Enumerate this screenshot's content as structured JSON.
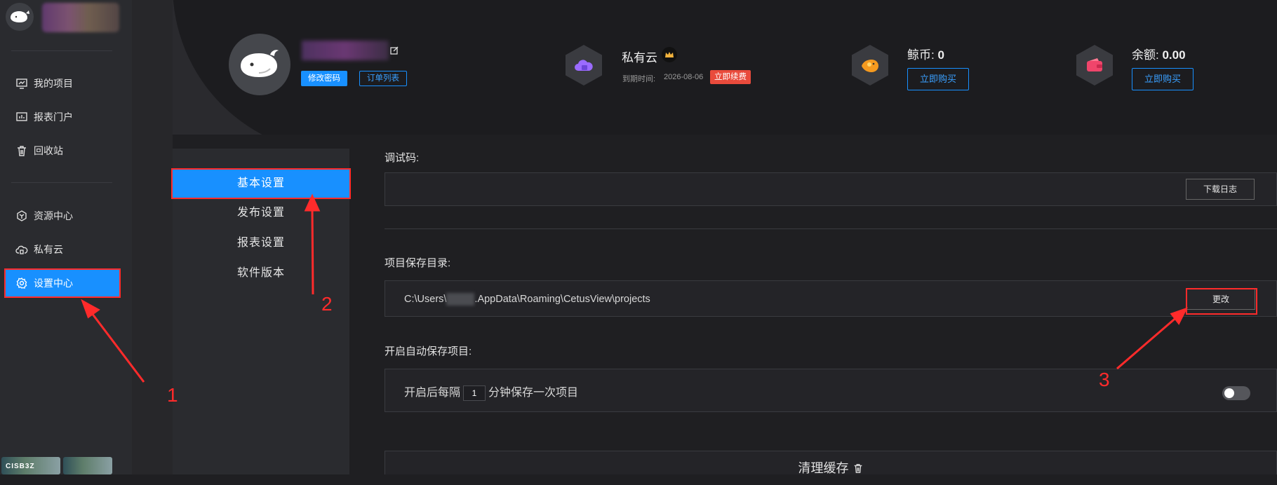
{
  "sidebar": {
    "items": [
      {
        "label": "我的项目",
        "icon": "monitor-chart-icon"
      },
      {
        "label": "报表门户",
        "icon": "dashboard-icon"
      },
      {
        "label": "回收站",
        "icon": "trash-icon"
      },
      {
        "label": "资源中心",
        "icon": "cube-icon"
      },
      {
        "label": "私有云",
        "icon": "cloud-lock-icon"
      },
      {
        "label": "设置中心",
        "icon": "gear-icon"
      }
    ],
    "thumbnail_label": "CISB3Z"
  },
  "header": {
    "change_password": "修改密码",
    "order_list": "订单列表",
    "cloud": {
      "title": "私有云",
      "expire_label": "到期时间:",
      "expire_date": "2026-08-06",
      "renew": "立即续费"
    },
    "coins": {
      "label": "鲸币:",
      "value": "0",
      "buy": "立即购买"
    },
    "balance": {
      "label": "余额:",
      "value": "0.00",
      "buy": "立即购买"
    }
  },
  "settings_menu": [
    "基本设置",
    "发布设置",
    "报表设置",
    "软件版本"
  ],
  "main": {
    "debug_label": "调试码:",
    "download_log": "下载日志",
    "save_dir_label": "项目保存目录:",
    "path_prefix": "C:\\Users\\",
    "path_suffix": ".AppData\\Roaming\\CetusView\\projects",
    "change_button": "更改",
    "autosave_label": "开启自动保存项目:",
    "autosave_prefix": "开启后每隔",
    "autosave_interval": "1",
    "autosave_suffix": "分钟保存一次项目",
    "autosave_enabled": false,
    "clear_cache": "清理缓存"
  },
  "annotations": [
    "1",
    "2",
    "3"
  ],
  "colors": {
    "accent": "#1890ff",
    "annotation": "#ff2b2b",
    "renew_tag": "#e94b3c"
  }
}
